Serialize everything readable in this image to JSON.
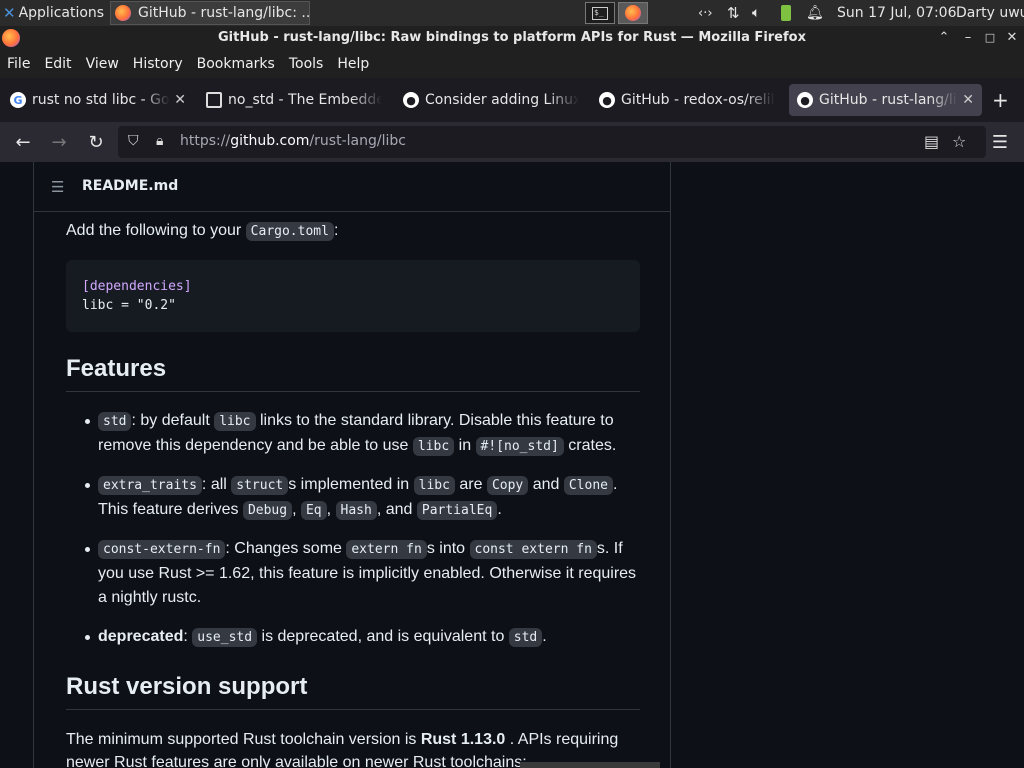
{
  "taskbar": {
    "applications_label": "Applications",
    "window_title": "GitHub - rust-lang/libc: ...",
    "clock": "Sun 17 Jul, 07:06",
    "user": "Darty uwu"
  },
  "window": {
    "title": "GitHub - rust-lang/libc: Raw bindings to platform APIs for Rust — Mozilla Firefox"
  },
  "menu": [
    "File",
    "Edit",
    "View",
    "History",
    "Bookmarks",
    "Tools",
    "Help"
  ],
  "tabs": [
    {
      "label": "rust no std libc - Google Search"
    },
    {
      "label": "no_std - The Embedded Rust Book"
    },
    {
      "label": "Consider adding Linux support"
    },
    {
      "label": "GitHub - redox-os/relibc"
    },
    {
      "label": "GitHub - rust-lang/libc"
    }
  ],
  "url": {
    "prefix": "https://",
    "host": "github.com",
    "path": "/rust-lang/libc"
  },
  "readme": {
    "file_name": "README.md",
    "add_text": "Add the following to your",
    "add_code": "Cargo.toml",
    "add_colon": ":",
    "code_section": "[dependencies]",
    "code_line": "libc = \"0.2\"",
    "features_heading": "Features",
    "features": {
      "std": {
        "c1": "std",
        "t1": ": by default ",
        "c2": "libc",
        "t2": " links to the standard library. Disable this feature to",
        "t3": "remove this dependency and be able to use ",
        "c3": "libc",
        "t4": " in ",
        "c4": "#![no_std]",
        "t5": " crates."
      },
      "extra": {
        "c1": "extra_traits",
        "t1": ": all ",
        "c2": "struct",
        "t2": "s implemented in ",
        "c3": "libc",
        "t3": " are ",
        "c4": "Copy",
        "t4": " and ",
        "c5": "Clone",
        "t5": ".",
        "t6": "This feature derives ",
        "c6": "Debug",
        "t7": ", ",
        "c7": "Eq",
        "t8": ", ",
        "c8": "Hash",
        "t9": ", and ",
        "c9": "PartialEq",
        "t10": "."
      },
      "const": {
        "c1": "const-extern-fn",
        "t1": ": Changes some ",
        "c2": "extern fn",
        "t2": "s into ",
        "c3": "const extern fn",
        "t3": "s. If",
        "l2": "you use Rust >= 1.62, this feature is implicitly enabled. Otherwise it requires",
        "l3": "a nightly rustc."
      },
      "deprecated": {
        "b1": "deprecated",
        "t1": ": ",
        "c1": "use_std",
        "t2": " is deprecated, and is equivalent to ",
        "c2": "std",
        "t3": "."
      }
    },
    "rust_heading": "Rust version support",
    "rust_p1": "The minimum supported Rust toolchain version is ",
    "rust_version": "Rust 1.13.0",
    "rust_p1_end": " . APIs requiring",
    "rust_p2": "newer Rust features are only available on newer Rust toolchains:"
  }
}
